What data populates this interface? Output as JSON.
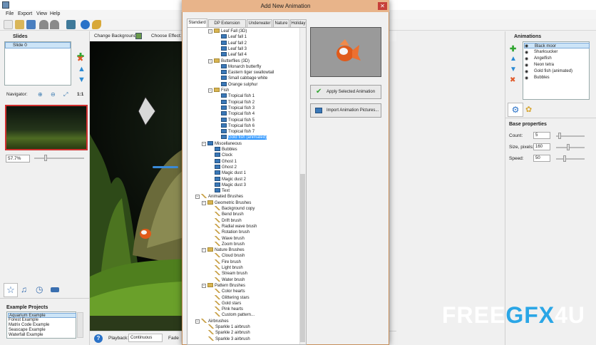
{
  "menu": [
    "File",
    "Export",
    "View",
    "Help"
  ],
  "toolbar": {
    "change_background": "Change Background",
    "choose_effect": "Choose Effect:"
  },
  "slides": {
    "title": "Slides",
    "items": [
      "Slide 0"
    ]
  },
  "navigator": {
    "title": "Navigator:",
    "ratio_label": "1:1",
    "zoom": "57.7%"
  },
  "example_projects": {
    "title": "Example Projects",
    "items": [
      "Aquarium Example",
      "Forest Example",
      "Matrix Code Example",
      "Seascape Example",
      "Waterfall Example"
    ]
  },
  "bottom": {
    "playback_label": "Playback:",
    "playback_value": "Continuous",
    "fade_label": "Fade"
  },
  "dialog": {
    "title": "Add New Animation",
    "close_glyph": "✕",
    "tabs": [
      "Standard",
      "DP Extension Pack",
      "Underwater",
      "Nature",
      "Holiday"
    ],
    "apply_button": "Apply Selected Animation",
    "import_button": "Import Animation Pictures...",
    "tree": [
      {
        "label": "Leaf Fall (3D)",
        "indent": 1,
        "icon": "folder",
        "expander": "−"
      },
      {
        "label": "Leaf fall 1",
        "indent": 3,
        "icon": "film"
      },
      {
        "label": "Leaf fall 2",
        "indent": 3,
        "icon": "film"
      },
      {
        "label": "Leaf fall 3",
        "indent": 3,
        "icon": "film"
      },
      {
        "label": "Leaf fall 4",
        "indent": 3,
        "icon": "film"
      },
      {
        "label": "Butterflies (3D)",
        "indent": 1,
        "icon": "folder",
        "expander": "−"
      },
      {
        "label": "Monarch butterfly",
        "indent": 3,
        "icon": "film"
      },
      {
        "label": "Eastern tiger swallowtail",
        "indent": 3,
        "icon": "film"
      },
      {
        "label": "Small cabbage white",
        "indent": 3,
        "icon": "film"
      },
      {
        "label": "Orange sulphur",
        "indent": 3,
        "icon": "film"
      },
      {
        "label": "Fish",
        "indent": 1,
        "icon": "folder",
        "expander": "−"
      },
      {
        "label": "Tropical fish 1",
        "indent": 3,
        "icon": "film"
      },
      {
        "label": "Tropical fish 2",
        "indent": 3,
        "icon": "film"
      },
      {
        "label": "Tropical fish 3",
        "indent": 3,
        "icon": "film"
      },
      {
        "label": "Tropical fish 4",
        "indent": 3,
        "icon": "film"
      },
      {
        "label": "Tropical fish 5",
        "indent": 3,
        "icon": "film"
      },
      {
        "label": "Tropical fish 6",
        "indent": 3,
        "icon": "film"
      },
      {
        "label": "Tropical fish 7",
        "indent": 3,
        "icon": "film"
      },
      {
        "label": "Gold fish (animated)",
        "indent": 3,
        "icon": "film",
        "selected": true
      },
      {
        "label": "Miscellaneous",
        "indent": 0,
        "icon": "film",
        "expander": "−"
      },
      {
        "label": "Bubbles",
        "indent": 2,
        "icon": "film"
      },
      {
        "label": "Clock",
        "indent": 2,
        "icon": "film"
      },
      {
        "label": "Ghost 1",
        "indent": 2,
        "icon": "film"
      },
      {
        "label": "Ghost 2",
        "indent": 2,
        "icon": "film"
      },
      {
        "label": "Magic dust 1",
        "indent": 2,
        "icon": "film"
      },
      {
        "label": "Magic dust 2",
        "indent": 2,
        "icon": "film"
      },
      {
        "label": "Magic dust 3",
        "indent": 2,
        "icon": "film"
      },
      {
        "label": "Text",
        "indent": 2,
        "icon": "film"
      },
      {
        "label": "Animated Brushes",
        "indent": -1,
        "icon": "brush",
        "expander": "−"
      },
      {
        "label": "Geometric Brushes",
        "indent": 0,
        "icon": "folder",
        "expander": "−"
      },
      {
        "label": "Background copy",
        "indent": 2,
        "icon": "brush"
      },
      {
        "label": "Bend brush",
        "indent": 2,
        "icon": "brush"
      },
      {
        "label": "Drift brush",
        "indent": 2,
        "icon": "brush"
      },
      {
        "label": "Radial wave brush",
        "indent": 2,
        "icon": "brush"
      },
      {
        "label": "Rotation brush",
        "indent": 2,
        "icon": "brush"
      },
      {
        "label": "Wave brush",
        "indent": 2,
        "icon": "brush"
      },
      {
        "label": "Zoom brush",
        "indent": 2,
        "icon": "brush"
      },
      {
        "label": "Nature Brushes",
        "indent": 0,
        "icon": "folder",
        "expander": "−"
      },
      {
        "label": "Cloud brush",
        "indent": 2,
        "icon": "brush"
      },
      {
        "label": "Fire brush",
        "indent": 2,
        "icon": "brush"
      },
      {
        "label": "Light brush",
        "indent": 2,
        "icon": "brush"
      },
      {
        "label": "Stream brush",
        "indent": 2,
        "icon": "brush"
      },
      {
        "label": "Water brush",
        "indent": 2,
        "icon": "brush"
      },
      {
        "label": "Pattern Brushes",
        "indent": 0,
        "icon": "folder",
        "expander": "−"
      },
      {
        "label": "Color hearts",
        "indent": 2,
        "icon": "brush"
      },
      {
        "label": "Glittering stars",
        "indent": 2,
        "icon": "brush"
      },
      {
        "label": "Gold stars",
        "indent": 2,
        "icon": "brush"
      },
      {
        "label": "Pink hearts",
        "indent": 2,
        "icon": "brush"
      },
      {
        "label": "Custom pattern...",
        "indent": 2,
        "icon": "brush"
      },
      {
        "label": "Airbrushes",
        "indent": -1,
        "icon": "brush",
        "expander": "−"
      },
      {
        "label": "Sparkle 1 airbrush",
        "indent": 1,
        "icon": "brush"
      },
      {
        "label": "Sparkle 2 airbrush",
        "indent": 1,
        "icon": "brush"
      },
      {
        "label": "Sparkle 3 airbrush",
        "indent": 1,
        "icon": "brush"
      }
    ]
  },
  "animations": {
    "title": "Animations",
    "items": [
      "Black moor",
      "Sharksucker",
      "Angelfish",
      "Neon tetra",
      "Gold fish (animated)",
      "Bubbles"
    ],
    "selected_index": 0
  },
  "base_properties": {
    "title": "Base properties",
    "count_label": "Count:",
    "count_value": "5",
    "size_label": "Size, pixels:",
    "size_value": "160",
    "speed_label": "Speed:",
    "speed_value": "50"
  },
  "watermark": {
    "part1": "FREE",
    "part2": "GFX",
    "part3": "4U"
  },
  "colors": {
    "dialog_title_bg": "#e8b48a",
    "selection": "#3399ff",
    "close": "#c7403a"
  }
}
